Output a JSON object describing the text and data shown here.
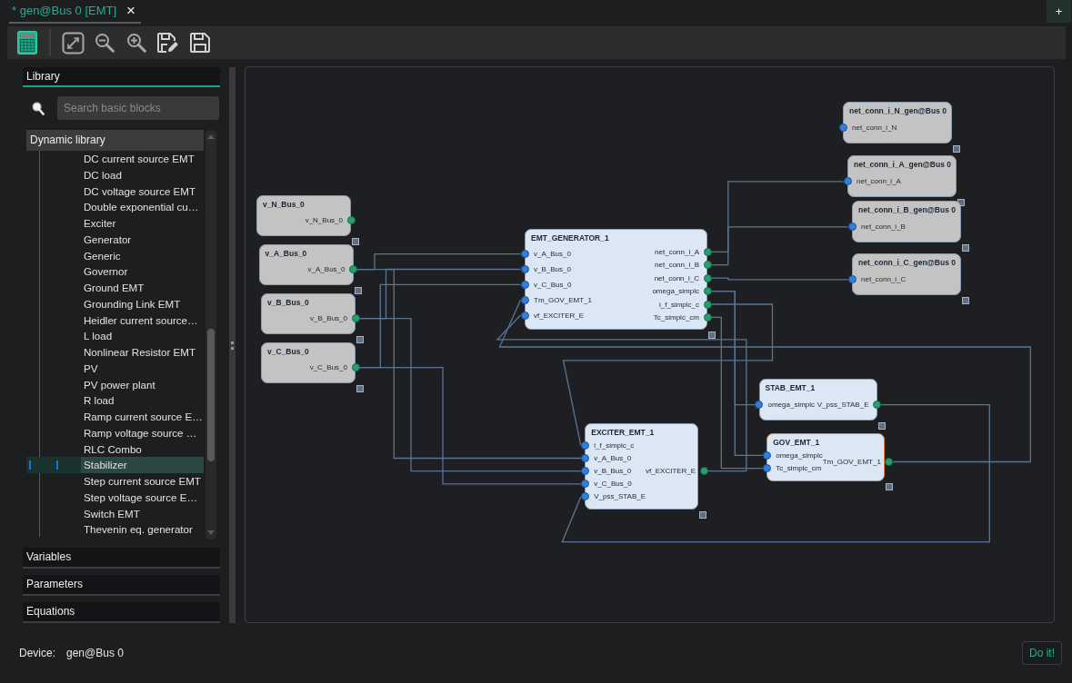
{
  "tabs": [
    {
      "label": "* gen@Bus 0 [EMT]",
      "selected": true,
      "close": "×"
    }
  ],
  "new_tab_button": "+",
  "toolbar": {
    "groups": [
      [
        {
          "kind": "calculator"
        }
      ],
      [
        {
          "kind": "fit_view"
        },
        {
          "kind": "zoom_out"
        },
        {
          "kind": "zoom_in"
        },
        {
          "kind": "save_as"
        },
        {
          "kind": "save"
        }
      ]
    ]
  },
  "sections": [
    {
      "title": "Library",
      "expanded": true,
      "search": {
        "placeholder": "Search basic blocks"
      },
      "tree": [
        {
          "label": "Dynamic library",
          "children": [
            {
              "label": "DC current source EMT",
              "selected": false
            },
            {
              "label": "DC load",
              "selected": false
            },
            {
              "label": "DC voltage source EMT",
              "selected": false
            },
            {
              "label": "Double exponential cu…",
              "selected": false
            },
            {
              "label": "Exciter",
              "selected": false
            },
            {
              "label": "Generator",
              "selected": false
            },
            {
              "label": "Generic",
              "selected": false
            },
            {
              "label": "Governor",
              "selected": false
            },
            {
              "label": "Ground EMT",
              "selected": false
            },
            {
              "label": "Grounding Link EMT",
              "selected": false
            },
            {
              "label": "Heidler current source…",
              "selected": false
            },
            {
              "label": "L load",
              "selected": false
            },
            {
              "label": "Nonlinear Resistor EMT",
              "selected": false
            },
            {
              "label": "PV",
              "selected": false
            },
            {
              "label": "PV power plant",
              "selected": false
            },
            {
              "label": "R load",
              "selected": false
            },
            {
              "label": "Ramp current source E…",
              "selected": false
            },
            {
              "label": "Ramp voltage source …",
              "selected": false
            },
            {
              "label": "RLC Combo",
              "selected": false
            },
            {
              "label": "Stabilizer",
              "selected": true
            },
            {
              "label": "Step current source EMT",
              "selected": false
            },
            {
              "label": "Step voltage source E…",
              "selected": false
            },
            {
              "label": "Switch EMT",
              "selected": false
            },
            {
              "label": "Thevenin eq. generator",
              "selected": false
            }
          ]
        }
      ]
    },
    {
      "title": "Variables",
      "expanded": false
    },
    {
      "title": "Parameters",
      "expanded": false
    },
    {
      "title": "Equations",
      "expanded": false
    }
  ],
  "diagram": {
    "nodes": [
      {
        "title": "v_N_Bus_0",
        "kind": "terminal",
        "selected": false,
        "outputs": [
          "v_N_Bus_0"
        ]
      },
      {
        "title": "v_A_Bus_0",
        "kind": "terminal",
        "selected": false,
        "outputs": [
          "v_A_Bus_0"
        ]
      },
      {
        "title": "v_B_Bus_0",
        "kind": "terminal",
        "selected": false,
        "outputs": [
          "v_B_Bus_0"
        ]
      },
      {
        "title": "v_C_Bus_0",
        "kind": "terminal",
        "selected": false,
        "outputs": [
          "v_C_Bus_0"
        ]
      },
      {
        "title": "EMT_GENERATOR_1",
        "kind": "block",
        "selected": false,
        "inputs": [
          "v_A_Bus_0",
          "v_B_Bus_0",
          "v_C_Bus_0",
          "Tm_GOV_EMT_1",
          "vf_EXCITER_E"
        ],
        "outputs": [
          "net_conn_i_A",
          "net_conn_i_B",
          "net_conn_i_C",
          "omega_simplc",
          "i_f_simplc_c",
          "Tc_simplc_cm"
        ]
      },
      {
        "title": "net_conn_i_N_gen@Bus 0",
        "kind": "terminal",
        "selected": false,
        "inputs": [
          "net_conn_i_N"
        ]
      },
      {
        "title": "net_conn_i_A_gen@Bus 0",
        "kind": "terminal",
        "selected": false,
        "inputs": [
          "net_conn_i_A"
        ]
      },
      {
        "title": "net_conn_i_B_gen@Bus 0",
        "kind": "terminal",
        "selected": false,
        "inputs": [
          "net_conn_i_B"
        ]
      },
      {
        "title": "net_conn_i_C_gen@Bus 0",
        "kind": "terminal",
        "selected": false,
        "inputs": [
          "net_conn_i_C"
        ]
      },
      {
        "title": "EXCITER_EMT_1",
        "kind": "block",
        "selected": false,
        "inputs": [
          "i_f_simplc_c",
          "v_A_Bus_0",
          "v_B_Bus_0",
          "v_C_Bus_0",
          "V_pss_STAB_E"
        ],
        "outputs": [
          "vf_EXCITER_E"
        ]
      },
      {
        "title": "STAB_EMT_1",
        "kind": "block",
        "selected": false,
        "inputs": [
          "omega_simplc"
        ],
        "outputs": [
          "V_pss_STAB_E"
        ]
      },
      {
        "title": "GOV_EMT_1",
        "kind": "block",
        "selected": true,
        "inputs": [
          "omega_simplc",
          "Tc_simplc_cm"
        ],
        "outputs": [
          "Tm_GOV_EMT_1"
        ]
      }
    ]
  },
  "status": {
    "label": "Device:",
    "value": "gen@Bus 0"
  },
  "action_button": "Do it!"
}
